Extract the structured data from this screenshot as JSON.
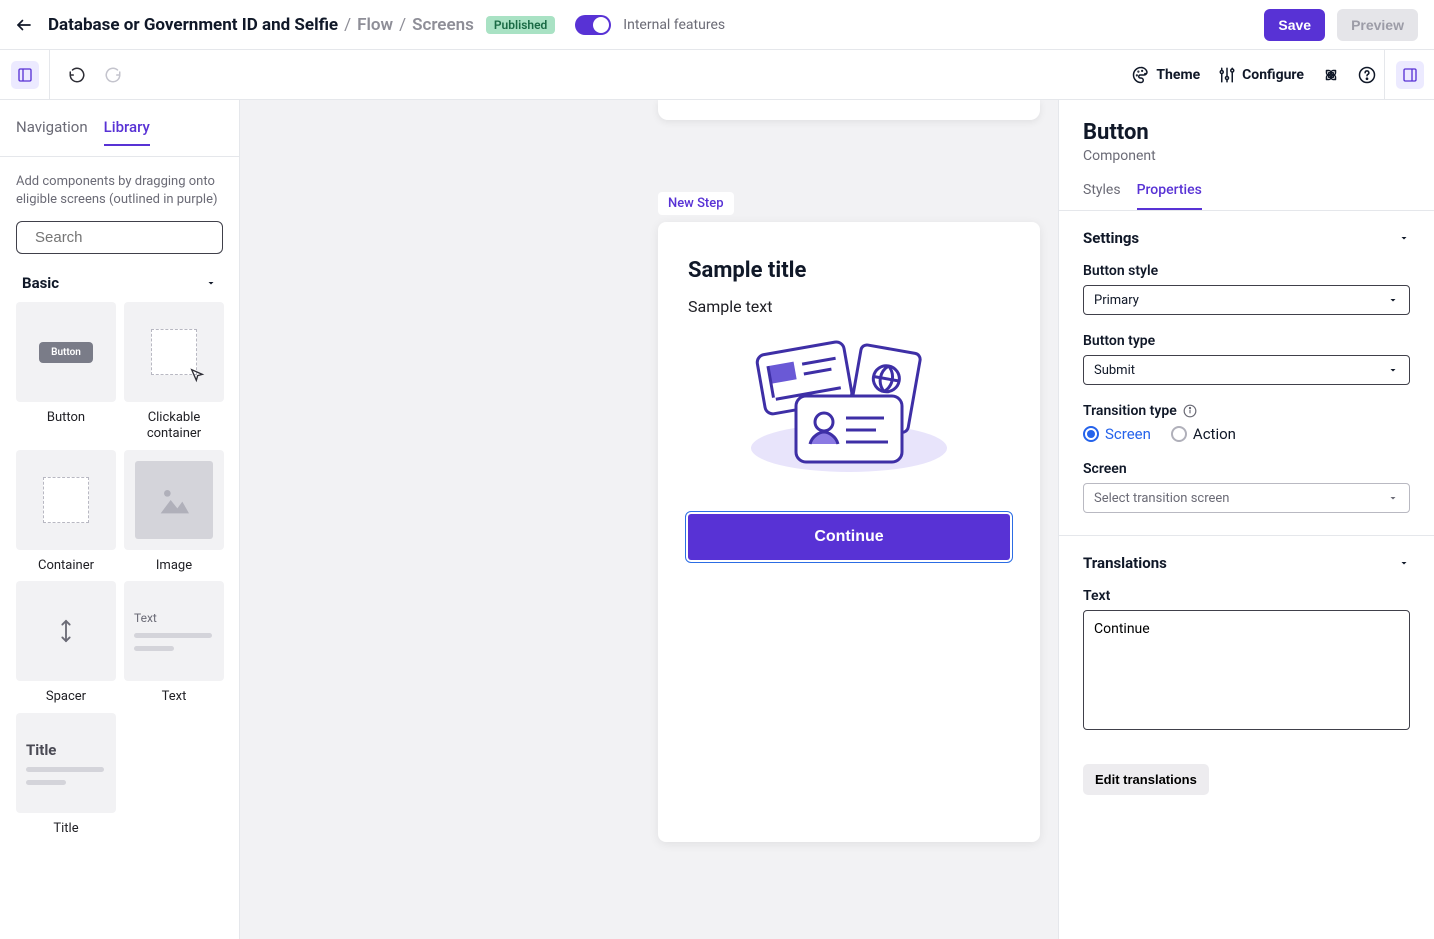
{
  "topbar": {
    "crumb_title": "Database or Government ID and Selfie",
    "crumb_flow": "Flow",
    "crumb_screens": "Screens",
    "badge": "Published",
    "internal_features": "Internal features",
    "save": "Save",
    "preview": "Preview"
  },
  "toolbar": {
    "theme": "Theme",
    "configure": "Configure"
  },
  "left": {
    "tab_navigation": "Navigation",
    "tab_library": "Library",
    "hint": "Add components by dragging onto eligible screens (outlined in purple)",
    "search_placeholder": "Search",
    "section_basic": "Basic",
    "items": [
      {
        "label": "Button"
      },
      {
        "label": "Clickable container"
      },
      {
        "label": "Container"
      },
      {
        "label": "Image"
      },
      {
        "label": "Spacer"
      },
      {
        "label": "Text"
      },
      {
        "label": "Title"
      }
    ],
    "thumb_button_text": "Button",
    "thumb_text_label": "Text",
    "thumb_title_label": "Title"
  },
  "canvas": {
    "step_tag": "New Step",
    "title": "Sample title",
    "body": "Sample text",
    "continue_btn": "Continue"
  },
  "right": {
    "heading": "Button",
    "subheading": "Component",
    "tab_styles": "Styles",
    "tab_properties": "Properties",
    "settings": {
      "title": "Settings",
      "button_style_label": "Button style",
      "button_style_value": "Primary",
      "button_type_label": "Button type",
      "button_type_value": "Submit",
      "transition_type_label": "Transition type",
      "transition_option_screen": "Screen",
      "transition_option_action": "Action",
      "screen_label": "Screen",
      "screen_value": "Select transition screen"
    },
    "translations": {
      "title": "Translations",
      "text_label": "Text",
      "text_value": "Continue",
      "edit_btn": "Edit translations"
    }
  }
}
